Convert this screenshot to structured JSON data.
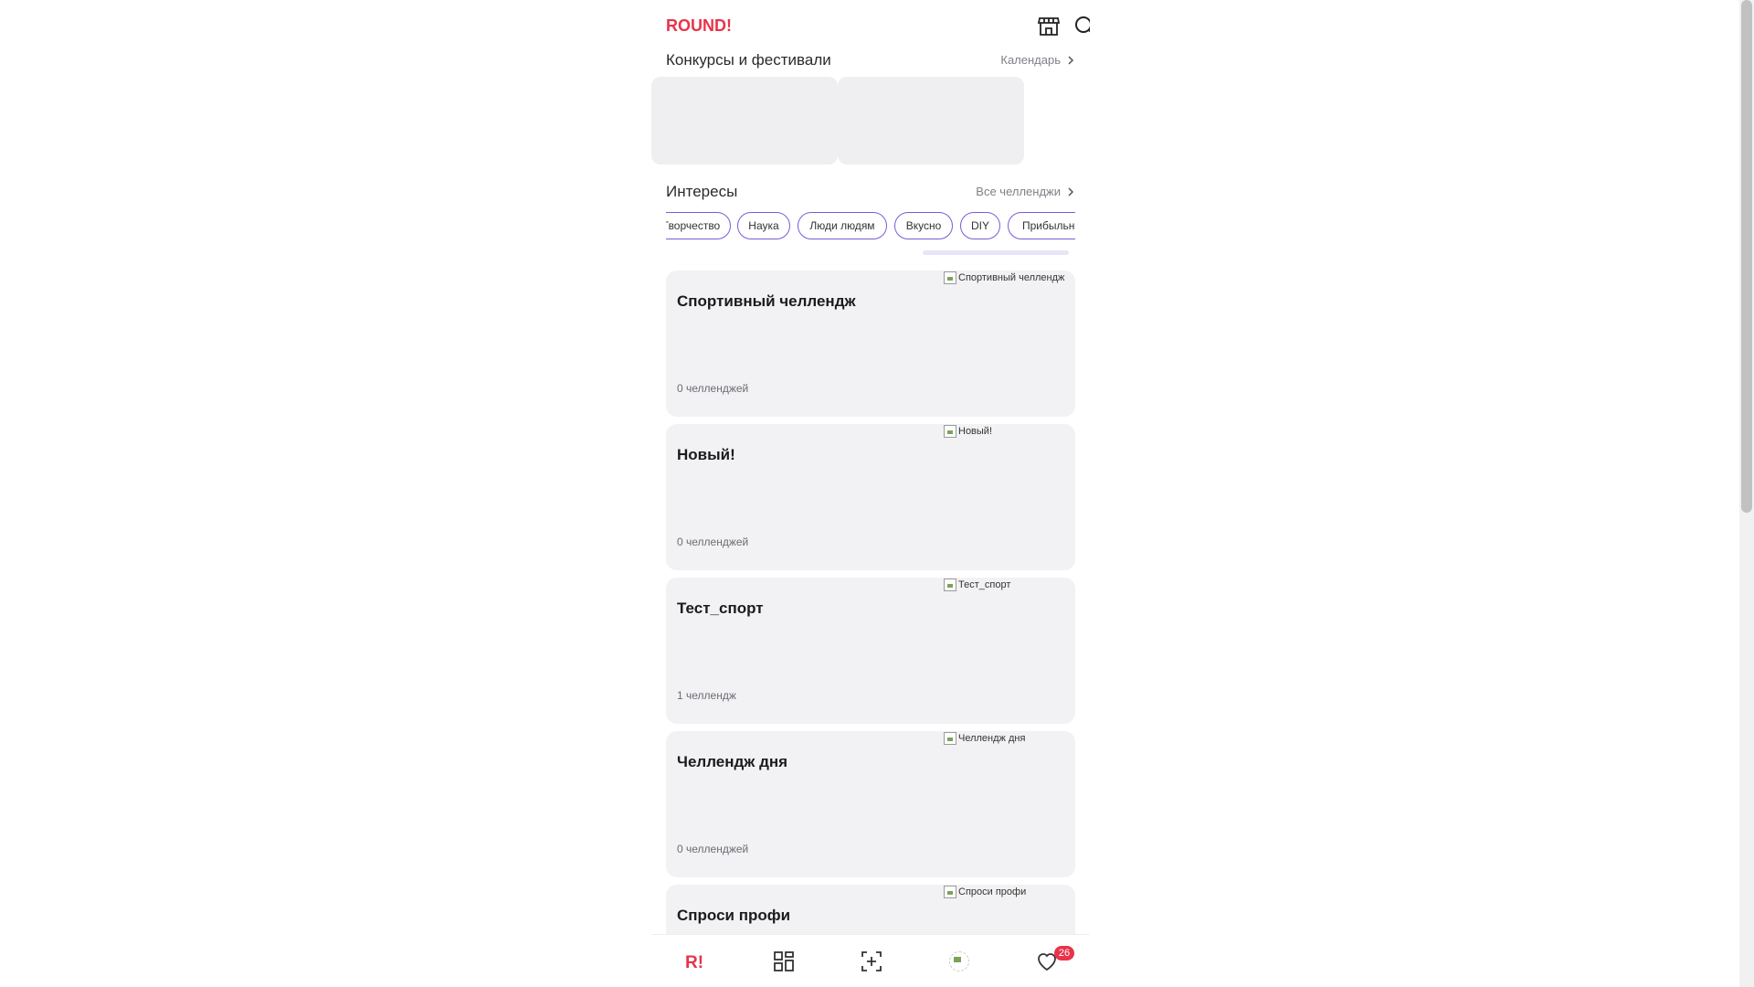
{
  "brand": {
    "logo_text": "ROUND!",
    "accent": "#e8334a",
    "chip_border": "#7a5bd6"
  },
  "header": {
    "icons": [
      "store-icon",
      "search-icon"
    ]
  },
  "contests": {
    "title": "Конкурсы и фестивали",
    "link": "Календарь"
  },
  "interests": {
    "title": "Интересы",
    "link": "Все челленджи",
    "chips": [
      "Творчество",
      "Наука",
      "Люди людям",
      "Вкусно",
      "DIY",
      "Прибыльно"
    ]
  },
  "cards": [
    {
      "title": "Спортивный челлендж",
      "count": "0 челленджей",
      "img_alt": "Спортивный челлендж"
    },
    {
      "title": "Новый!",
      "count": "0 челленджей",
      "img_alt": "Новый!"
    },
    {
      "title": "Тест_спорт",
      "count": "1 челлендж",
      "img_alt": "Тест_спорт"
    },
    {
      "title": "Челлендж дня",
      "count": "0 челленджей",
      "img_alt": "Челлендж дня"
    },
    {
      "title": "Спроси профи",
      "count": "",
      "img_alt": "Спроси профи"
    }
  ],
  "bottom_nav": {
    "items": [
      "home-logo-icon",
      "catalog-grid-icon",
      "add-challenge-icon",
      "avatar",
      "favorites-heart-icon"
    ],
    "favorites_badge": "26"
  }
}
